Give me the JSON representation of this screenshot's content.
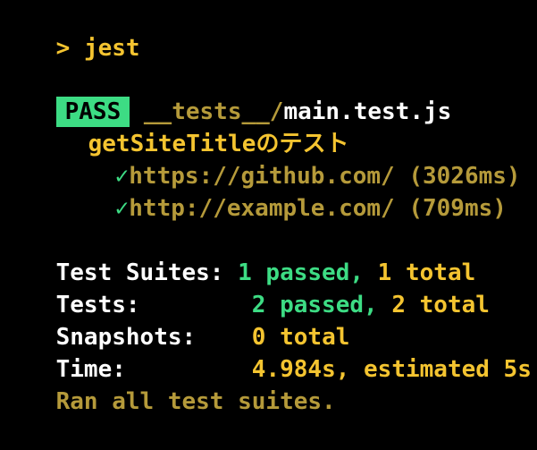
{
  "prompt": {
    "symbol": ">",
    "command": "jest"
  },
  "result": {
    "badge": "PASS",
    "test_dir": "__tests__/",
    "test_file": "main.test.js"
  },
  "describe_block": "getSiteTitleのテスト",
  "tests": [
    {
      "status_icon": "✓",
      "name": "https://github.com/ (3026ms)"
    },
    {
      "status_icon": "✓",
      "name": "http://example.com/ (709ms)"
    }
  ],
  "summary": {
    "suites_label": "Test Suites:",
    "suites_passed": "1 passed,",
    "suites_total": "1 total",
    "tests_label": "Tests:",
    "tests_passed": "2 passed,",
    "tests_total": "2 total",
    "snapshots_label": "Snapshots:",
    "snapshots_total": "0 total",
    "time_label": "Time:",
    "time_value": "4.984s, estimated 5s",
    "footer": "Ran all test suites."
  },
  "colors": {
    "prompt": "#f4c430",
    "pass": "#3ddc84",
    "dim": "#b59a3a",
    "text": "#ffffff",
    "background": "#000000"
  }
}
